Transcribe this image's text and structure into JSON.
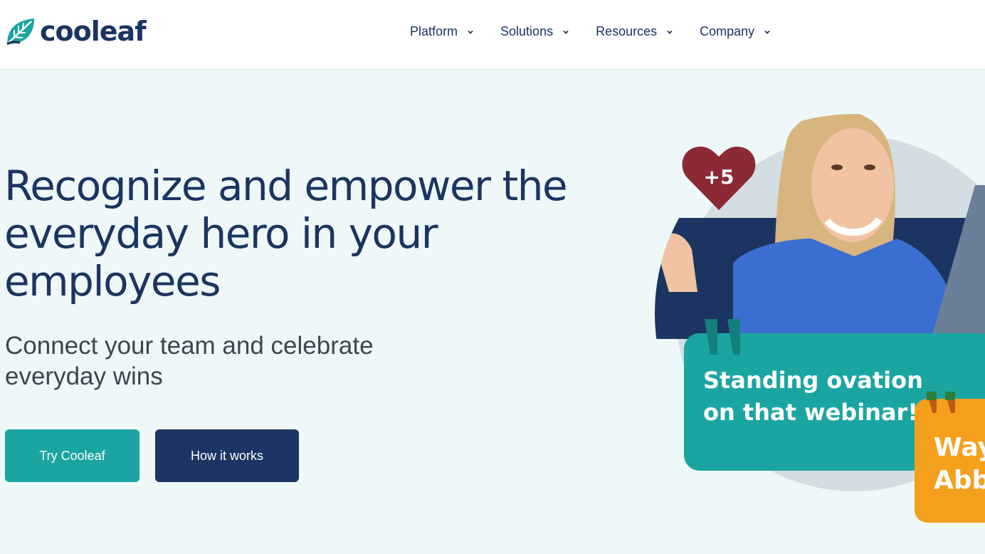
{
  "brand": {
    "name": "cooleaf"
  },
  "nav": [
    {
      "label": "Platform"
    },
    {
      "label": "Solutions"
    },
    {
      "label": "Resources"
    },
    {
      "label": "Company"
    }
  ],
  "hero": {
    "title": "Recognize and empower the everyday hero in your employees",
    "subtitle": "Connect your team and celebrate everyday wins",
    "primary_cta": "Try Cooleaf",
    "secondary_cta": "How it works"
  },
  "visual": {
    "heart_badge": "+5",
    "quote_card_line1": "Standing ovation",
    "quote_card_line2": "on that webinar!",
    "second_card_line1": "Way",
    "second_card_line2": "Abb"
  },
  "colors": {
    "navy": "#1c3461",
    "teal": "#1aa5a2",
    "orange": "#f5a01d",
    "heart": "#8b2a35",
    "background": "#eef8f8"
  }
}
